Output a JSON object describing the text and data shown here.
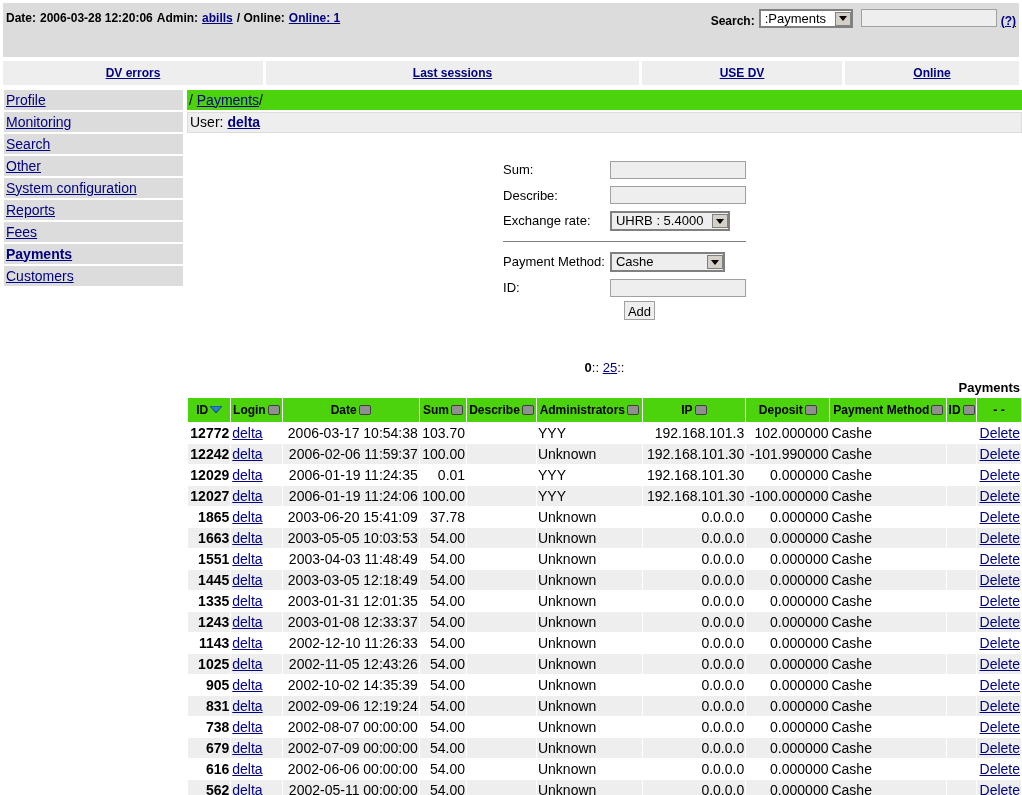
{
  "header": {
    "date_label": "Date:",
    "date": "2006-03-28 12:20:06",
    "admin_label": "Admin:",
    "admin": "abills",
    "online_label": "/ Online:",
    "online": "Online: 1",
    "search_label": "Search:",
    "search_select": ":Payments",
    "help": "(?)"
  },
  "nav": [
    "DV errors",
    "Last sessions",
    "USE DV",
    "Online"
  ],
  "sidebar": [
    {
      "label": "Profile",
      "selected": false
    },
    {
      "label": "Monitoring",
      "selected": false
    },
    {
      "label": "Search",
      "selected": false
    },
    {
      "label": "Other",
      "selected": false
    },
    {
      "label": "System configuration",
      "selected": false
    },
    {
      "label": "Reports",
      "selected": false
    },
    {
      "label": "Fees",
      "selected": false
    },
    {
      "label": "Payments",
      "selected": true
    },
    {
      "label": "Customers",
      "selected": false
    }
  ],
  "breadcrumb": {
    "sep": "/",
    "link": "Payments",
    "tail": "/"
  },
  "user": {
    "label": "User:",
    "name": "delta"
  },
  "form": {
    "sum_label": "Sum:",
    "describe_label": "Describe:",
    "rate_label": "Exchange rate:",
    "rate": "UHRB : 5.4000",
    "method_label": "Payment Method:",
    "method": "Cashe",
    "id_label": "ID:",
    "add": "Add"
  },
  "pager": {
    "current": "0",
    "sep1": "::",
    "next": "25",
    "sep2": "::"
  },
  "table": {
    "title": "Payments",
    "columns": [
      {
        "label": "ID",
        "sorted": true
      },
      {
        "label": "Login",
        "sorted": false
      },
      {
        "label": "Date",
        "sorted": false
      },
      {
        "label": "Sum",
        "sorted": false
      },
      {
        "label": "Describe",
        "sorted": false
      },
      {
        "label": "Administrators",
        "sorted": false
      },
      {
        "label": "IP",
        "sorted": false
      },
      {
        "label": "Deposit",
        "sorted": false
      },
      {
        "label": "Payment Method",
        "sorted": false
      },
      {
        "label": "ID",
        "sorted": false
      },
      {
        "label": "- -",
        "kind": "plain"
      }
    ],
    "rows": [
      [
        "12772",
        "delta",
        "2006-03-17 10:54:38",
        "103.70",
        "",
        "YYY",
        "192.168.101.3",
        "102.000000",
        "Cashe",
        "",
        "Delete"
      ],
      [
        "12242",
        "delta",
        "2006-02-06 11:59:37",
        "100.00",
        "",
        "Unknown",
        "192.168.101.30",
        "-101.990000",
        "Cashe",
        "",
        "Delete"
      ],
      [
        "12029",
        "delta",
        "2006-01-19 11:24:35",
        "0.01",
        "",
        "YYY",
        "192.168.101.30",
        "0.000000",
        "Cashe",
        "",
        "Delete"
      ],
      [
        "12027",
        "delta",
        "2006-01-19 11:24:06",
        "100.00",
        "",
        "YYY",
        "192.168.101.30",
        "-100.000000",
        "Cashe",
        "",
        "Delete"
      ],
      [
        "1865",
        "delta",
        "2003-06-20 15:41:09",
        "37.78",
        "",
        "Unknown",
        "0.0.0.0",
        "0.000000",
        "Cashe",
        "",
        "Delete"
      ],
      [
        "1663",
        "delta",
        "2003-05-05 10:03:53",
        "54.00",
        "",
        "Unknown",
        "0.0.0.0",
        "0.000000",
        "Cashe",
        "",
        "Delete"
      ],
      [
        "1551",
        "delta",
        "2003-04-03 11:48:49",
        "54.00",
        "",
        "Unknown",
        "0.0.0.0",
        "0.000000",
        "Cashe",
        "",
        "Delete"
      ],
      [
        "1445",
        "delta",
        "2003-03-05 12:18:49",
        "54.00",
        "",
        "Unknown",
        "0.0.0.0",
        "0.000000",
        "Cashe",
        "",
        "Delete"
      ],
      [
        "1335",
        "delta",
        "2003-01-31 12:01:35",
        "54.00",
        "",
        "Unknown",
        "0.0.0.0",
        "0.000000",
        "Cashe",
        "",
        "Delete"
      ],
      [
        "1243",
        "delta",
        "2003-01-08 12:33:37",
        "54.00",
        "",
        "Unknown",
        "0.0.0.0",
        "0.000000",
        "Cashe",
        "",
        "Delete"
      ],
      [
        "1143",
        "delta",
        "2002-12-10 11:26:33",
        "54.00",
        "",
        "Unknown",
        "0.0.0.0",
        "0.000000",
        "Cashe",
        "",
        "Delete"
      ],
      [
        "1025",
        "delta",
        "2002-11-05 12:43:26",
        "54.00",
        "",
        "Unknown",
        "0.0.0.0",
        "0.000000",
        "Cashe",
        "",
        "Delete"
      ],
      [
        "905",
        "delta",
        "2002-10-02 14:35:39",
        "54.00",
        "",
        "Unknown",
        "0.0.0.0",
        "0.000000",
        "Cashe",
        "",
        "Delete"
      ],
      [
        "831",
        "delta",
        "2002-09-06 12:19:24",
        "54.00",
        "",
        "Unknown",
        "0.0.0.0",
        "0.000000",
        "Cashe",
        "",
        "Delete"
      ],
      [
        "738",
        "delta",
        "2002-08-07 00:00:00",
        "54.00",
        "",
        "Unknown",
        "0.0.0.0",
        "0.000000",
        "Cashe",
        "",
        "Delete"
      ],
      [
        "679",
        "delta",
        "2002-07-09 00:00:00",
        "54.00",
        "",
        "Unknown",
        "0.0.0.0",
        "0.000000",
        "Cashe",
        "",
        "Delete"
      ],
      [
        "616",
        "delta",
        "2002-06-06 00:00:00",
        "54.00",
        "",
        "Unknown",
        "0.0.0.0",
        "0.000000",
        "Cashe",
        "",
        "Delete"
      ],
      [
        "562",
        "delta",
        "2002-05-11 00:00:00",
        "54.00",
        "",
        "Unknown",
        "0.0.0.0",
        "0.000000",
        "Cashe",
        "",
        "Delete"
      ]
    ]
  }
}
